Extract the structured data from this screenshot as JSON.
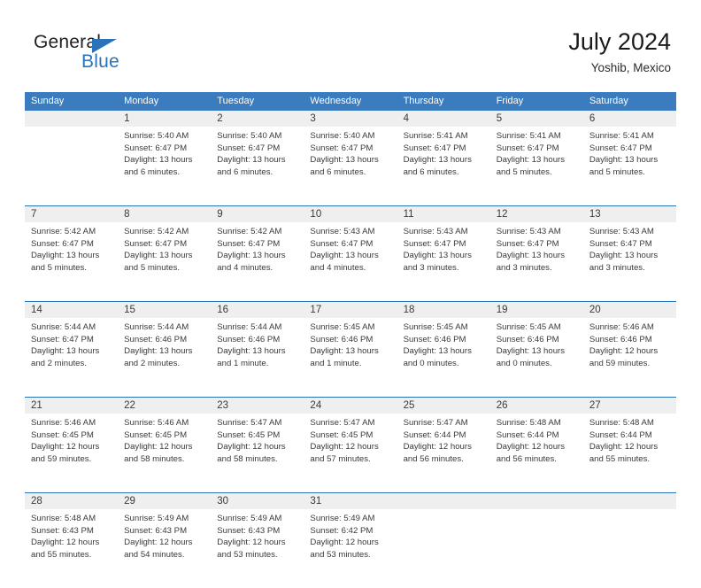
{
  "brand": {
    "name_top": "General",
    "name_bottom": "Blue",
    "accent_color": "#2b73b8"
  },
  "header": {
    "title": "July 2024",
    "subtitle": "Yoshib, Mexico"
  },
  "theme": {
    "header_row_bg": "#3a7cbe",
    "week_divider": "#2b73b8",
    "daynum_band_bg": "#efefef",
    "text_color": "#3a3a3a"
  },
  "weekdays": [
    "Sunday",
    "Monday",
    "Tuesday",
    "Wednesday",
    "Thursday",
    "Friday",
    "Saturday"
  ],
  "labels": {
    "sunrise_prefix": "Sunrise:",
    "sunset_prefix": "Sunset:",
    "daylight_prefix": "Daylight:"
  },
  "weeks": [
    {
      "days": [
        {
          "num": "",
          "empty": true
        },
        {
          "num": "1",
          "sunrise": "Sunrise: 5:40 AM",
          "sunset": "Sunset: 6:47 PM",
          "daylight1": "Daylight: 13 hours",
          "daylight2": "and 6 minutes."
        },
        {
          "num": "2",
          "sunrise": "Sunrise: 5:40 AM",
          "sunset": "Sunset: 6:47 PM",
          "daylight1": "Daylight: 13 hours",
          "daylight2": "and 6 minutes."
        },
        {
          "num": "3",
          "sunrise": "Sunrise: 5:40 AM",
          "sunset": "Sunset: 6:47 PM",
          "daylight1": "Daylight: 13 hours",
          "daylight2": "and 6 minutes."
        },
        {
          "num": "4",
          "sunrise": "Sunrise: 5:41 AM",
          "sunset": "Sunset: 6:47 PM",
          "daylight1": "Daylight: 13 hours",
          "daylight2": "and 6 minutes."
        },
        {
          "num": "5",
          "sunrise": "Sunrise: 5:41 AM",
          "sunset": "Sunset: 6:47 PM",
          "daylight1": "Daylight: 13 hours",
          "daylight2": "and 5 minutes."
        },
        {
          "num": "6",
          "sunrise": "Sunrise: 5:41 AM",
          "sunset": "Sunset: 6:47 PM",
          "daylight1": "Daylight: 13 hours",
          "daylight2": "and 5 minutes."
        }
      ]
    },
    {
      "days": [
        {
          "num": "7",
          "sunrise": "Sunrise: 5:42 AM",
          "sunset": "Sunset: 6:47 PM",
          "daylight1": "Daylight: 13 hours",
          "daylight2": "and 5 minutes."
        },
        {
          "num": "8",
          "sunrise": "Sunrise: 5:42 AM",
          "sunset": "Sunset: 6:47 PM",
          "daylight1": "Daylight: 13 hours",
          "daylight2": "and 5 minutes."
        },
        {
          "num": "9",
          "sunrise": "Sunrise: 5:42 AM",
          "sunset": "Sunset: 6:47 PM",
          "daylight1": "Daylight: 13 hours",
          "daylight2": "and 4 minutes."
        },
        {
          "num": "10",
          "sunrise": "Sunrise: 5:43 AM",
          "sunset": "Sunset: 6:47 PM",
          "daylight1": "Daylight: 13 hours",
          "daylight2": "and 4 minutes."
        },
        {
          "num": "11",
          "sunrise": "Sunrise: 5:43 AM",
          "sunset": "Sunset: 6:47 PM",
          "daylight1": "Daylight: 13 hours",
          "daylight2": "and 3 minutes."
        },
        {
          "num": "12",
          "sunrise": "Sunrise: 5:43 AM",
          "sunset": "Sunset: 6:47 PM",
          "daylight1": "Daylight: 13 hours",
          "daylight2": "and 3 minutes."
        },
        {
          "num": "13",
          "sunrise": "Sunrise: 5:43 AM",
          "sunset": "Sunset: 6:47 PM",
          "daylight1": "Daylight: 13 hours",
          "daylight2": "and 3 minutes."
        }
      ]
    },
    {
      "days": [
        {
          "num": "14",
          "sunrise": "Sunrise: 5:44 AM",
          "sunset": "Sunset: 6:47 PM",
          "daylight1": "Daylight: 13 hours",
          "daylight2": "and 2 minutes."
        },
        {
          "num": "15",
          "sunrise": "Sunrise: 5:44 AM",
          "sunset": "Sunset: 6:46 PM",
          "daylight1": "Daylight: 13 hours",
          "daylight2": "and 2 minutes."
        },
        {
          "num": "16",
          "sunrise": "Sunrise: 5:44 AM",
          "sunset": "Sunset: 6:46 PM",
          "daylight1": "Daylight: 13 hours",
          "daylight2": "and 1 minute."
        },
        {
          "num": "17",
          "sunrise": "Sunrise: 5:45 AM",
          "sunset": "Sunset: 6:46 PM",
          "daylight1": "Daylight: 13 hours",
          "daylight2": "and 1 minute."
        },
        {
          "num": "18",
          "sunrise": "Sunrise: 5:45 AM",
          "sunset": "Sunset: 6:46 PM",
          "daylight1": "Daylight: 13 hours",
          "daylight2": "and 0 minutes."
        },
        {
          "num": "19",
          "sunrise": "Sunrise: 5:45 AM",
          "sunset": "Sunset: 6:46 PM",
          "daylight1": "Daylight: 13 hours",
          "daylight2": "and 0 minutes."
        },
        {
          "num": "20",
          "sunrise": "Sunrise: 5:46 AM",
          "sunset": "Sunset: 6:46 PM",
          "daylight1": "Daylight: 12 hours",
          "daylight2": "and 59 minutes."
        }
      ]
    },
    {
      "days": [
        {
          "num": "21",
          "sunrise": "Sunrise: 5:46 AM",
          "sunset": "Sunset: 6:45 PM",
          "daylight1": "Daylight: 12 hours",
          "daylight2": "and 59 minutes."
        },
        {
          "num": "22",
          "sunrise": "Sunrise: 5:46 AM",
          "sunset": "Sunset: 6:45 PM",
          "daylight1": "Daylight: 12 hours",
          "daylight2": "and 58 minutes."
        },
        {
          "num": "23",
          "sunrise": "Sunrise: 5:47 AM",
          "sunset": "Sunset: 6:45 PM",
          "daylight1": "Daylight: 12 hours",
          "daylight2": "and 58 minutes."
        },
        {
          "num": "24",
          "sunrise": "Sunrise: 5:47 AM",
          "sunset": "Sunset: 6:45 PM",
          "daylight1": "Daylight: 12 hours",
          "daylight2": "and 57 minutes."
        },
        {
          "num": "25",
          "sunrise": "Sunrise: 5:47 AM",
          "sunset": "Sunset: 6:44 PM",
          "daylight1": "Daylight: 12 hours",
          "daylight2": "and 56 minutes."
        },
        {
          "num": "26",
          "sunrise": "Sunrise: 5:48 AM",
          "sunset": "Sunset: 6:44 PM",
          "daylight1": "Daylight: 12 hours",
          "daylight2": "and 56 minutes."
        },
        {
          "num": "27",
          "sunrise": "Sunrise: 5:48 AM",
          "sunset": "Sunset: 6:44 PM",
          "daylight1": "Daylight: 12 hours",
          "daylight2": "and 55 minutes."
        }
      ]
    },
    {
      "days": [
        {
          "num": "28",
          "sunrise": "Sunrise: 5:48 AM",
          "sunset": "Sunset: 6:43 PM",
          "daylight1": "Daylight: 12 hours",
          "daylight2": "and 55 minutes."
        },
        {
          "num": "29",
          "sunrise": "Sunrise: 5:49 AM",
          "sunset": "Sunset: 6:43 PM",
          "daylight1": "Daylight: 12 hours",
          "daylight2": "and 54 minutes."
        },
        {
          "num": "30",
          "sunrise": "Sunrise: 5:49 AM",
          "sunset": "Sunset: 6:43 PM",
          "daylight1": "Daylight: 12 hours",
          "daylight2": "and 53 minutes."
        },
        {
          "num": "31",
          "sunrise": "Sunrise: 5:49 AM",
          "sunset": "Sunset: 6:42 PM",
          "daylight1": "Daylight: 12 hours",
          "daylight2": "and 53 minutes."
        },
        {
          "num": "",
          "empty": true
        },
        {
          "num": "",
          "empty": true
        },
        {
          "num": "",
          "empty": true
        }
      ]
    }
  ]
}
